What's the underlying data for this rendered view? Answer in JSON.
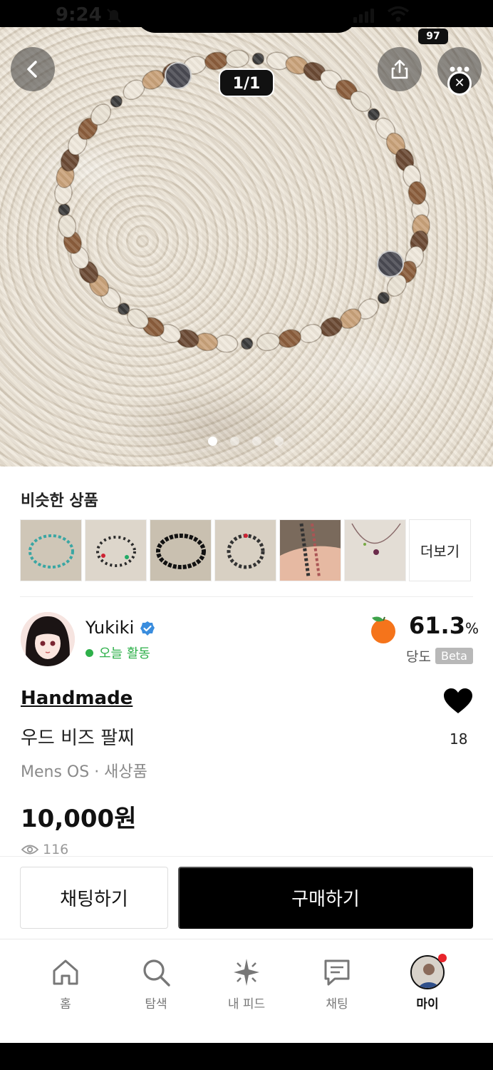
{
  "status_bar": {
    "time": "9:24",
    "battery": "97"
  },
  "hero": {
    "pager": "1/1",
    "dots_count": 4,
    "active_dot": 0
  },
  "similar": {
    "title": "비슷한 상품",
    "more_label": "더보기",
    "thumbnails": [
      "turquoise-bead-bracelet",
      "mixed-bead-bracelet",
      "black-bead-bracelet",
      "dark-bead-bracelet",
      "hand-held-bracelet",
      "pendant-necklace"
    ]
  },
  "seller": {
    "name": "Yukiki",
    "activity": "오늘 활동",
    "rate_value": "61.3",
    "rate_unit": "%",
    "rate_label": "당도",
    "beta": "Beta"
  },
  "product": {
    "brand": "Handmade",
    "name": "우드 비즈 팔찌",
    "meta": "Mens OS · 새상품",
    "price": "10,000원",
    "views": "116",
    "likes": "18"
  },
  "actions": {
    "chat": "채팅하기",
    "buy": "구매하기"
  },
  "tabs": [
    {
      "label": "홈",
      "icon": "home-icon"
    },
    {
      "label": "탐색",
      "icon": "search-icon"
    },
    {
      "label": "내 피드",
      "icon": "sparkle-icon"
    },
    {
      "label": "채팅",
      "icon": "chat-icon"
    },
    {
      "label": "마이",
      "icon": "profile-avatar"
    }
  ],
  "colors": {
    "accent": "#000000",
    "active_green": "#2eb04a",
    "notification": "#e8242b"
  }
}
